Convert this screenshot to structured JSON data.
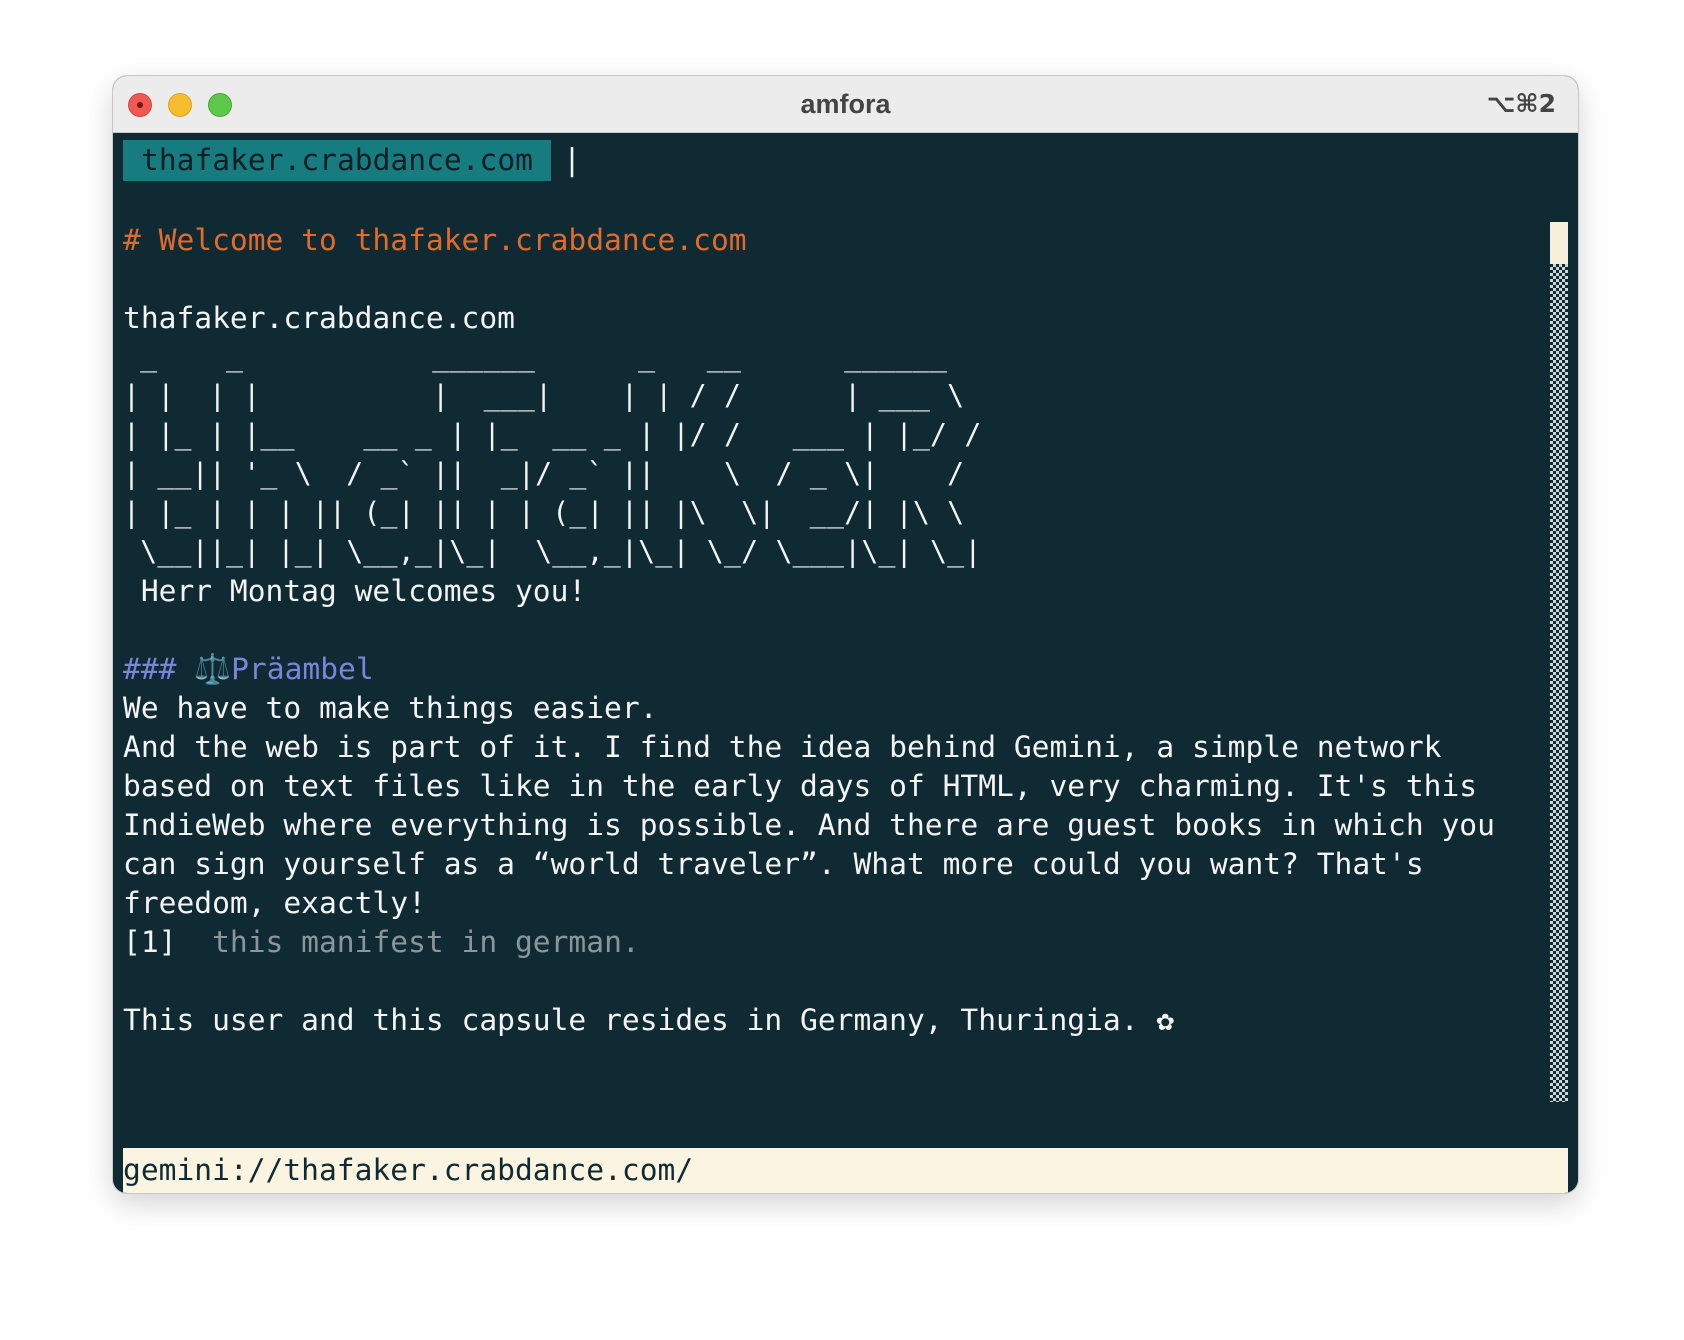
{
  "window": {
    "title": "amfora",
    "shortcut": "⌥⌘2"
  },
  "tab": {
    "label": "thafaker.crabdance.com",
    "separator": "|"
  },
  "content": {
    "heading1": "# Welcome to thafaker.crabdance.com",
    "host_line": "thafaker.crabdance.com",
    "ascii_art": [
      " _    _           ______      _   __      ______",
      "| |  | |          |  ___|    | | / /      | ___ \\",
      "| |_ | |__    __ _ | |_  __ _ | |/ /   ___ | |_/ /",
      "| __|| '_ \\  / _` ||  _|/ _` ||    \\  / _ \\|    /",
      "| |_ | | | || (_| || | | (_| || |\\  \\|  __/| |\\ \\",
      " \\__||_| |_| \\__,_|\\_|  \\__,_|\\_| \\_/ \\___|\\_| \\_|"
    ],
    "greeting": " Herr Montag welcomes you!",
    "heading3": "### ⚖️Präambel",
    "paragraph": [
      "We have to make things easier.",
      "And the web is part of it. I find the idea behind Gemini, a simple network",
      "based on text files like in the early days of HTML, very charming. It's this",
      "IndieWeb where everything is possible. And there are guest books in which you",
      "can sign yourself as a “world traveler”. What more could you want? That's",
      "freedom, exactly!"
    ],
    "link": {
      "number": "[1]",
      "text": "this manifest in german."
    },
    "footer_line": "This user and this capsule resides in Germany, Thuringia. ✿"
  },
  "status_bar": {
    "url": "gemini://thafaker.crabdance.com/"
  },
  "colors": {
    "background": "#0f2a33",
    "heading1": "#e16a2e",
    "heading3": "#7a85d8",
    "tab": "#167c80",
    "status_bar": "#fbf4e1",
    "link_text": "#8a969a"
  }
}
